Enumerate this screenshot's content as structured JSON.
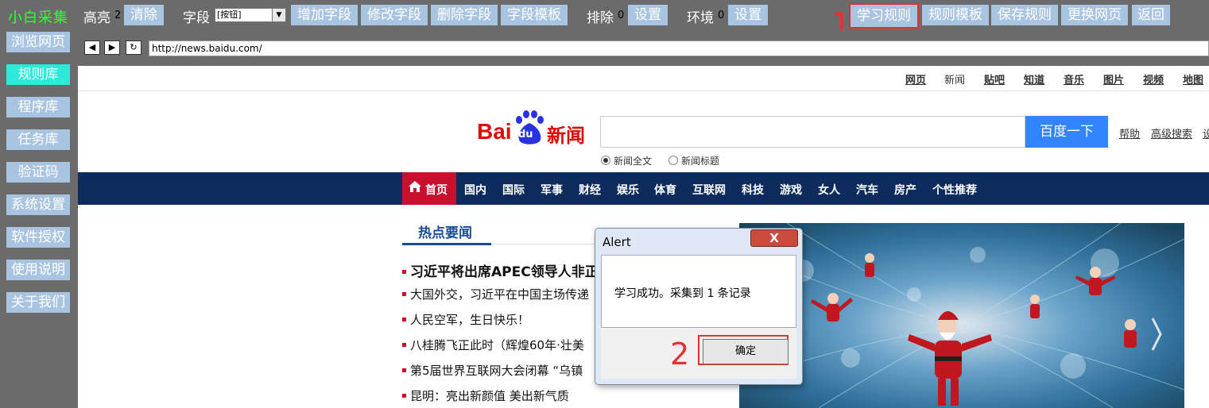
{
  "app": {
    "title": "小白采集"
  },
  "toolbar": {
    "highlight_label": "高亮",
    "highlight_count": "2",
    "clear_button": "清除",
    "field_label": "字段",
    "field_select_value": "[按钮]",
    "add_field": "增加字段",
    "edit_field": "修改字段",
    "delete_field": "删除字段",
    "field_template": "字段模板",
    "exclude_label": "排除",
    "exclude_count": "0",
    "exclude_settings": "设置",
    "env_label": "环境",
    "env_count": "0",
    "env_settings": "设置",
    "learn_rule": "学习规则",
    "rule_template": "规则模板",
    "save_rule": "保存规则",
    "change_page": "更换网页",
    "back": "返回"
  },
  "sidebar": {
    "items": [
      {
        "label": "浏览网页",
        "active": false
      },
      {
        "label": "规则库",
        "active": true
      },
      {
        "label": "程序库",
        "active": false
      },
      {
        "label": "任务库",
        "active": false
      },
      {
        "label": "验证码",
        "active": false
      },
      {
        "label": "系统设置",
        "active": false
      },
      {
        "label": "软件授权",
        "active": false
      },
      {
        "label": "使用说明",
        "active": false
      },
      {
        "label": "关于我们",
        "active": false
      }
    ]
  },
  "browser": {
    "url": "http://news.baidu.com/",
    "back_icon": "arrow-left-icon",
    "forward_icon": "arrow-right-icon",
    "refresh_icon": "refresh-icon"
  },
  "baidu": {
    "top_links": [
      "网页",
      "新闻",
      "贴吧",
      "知道",
      "音乐",
      "图片",
      "视频",
      "地图"
    ],
    "logo_text": "Bai",
    "logo_paw": "du",
    "logo_suffix": "新闻",
    "search_button": "百度一下",
    "help": "帮助",
    "advanced": "高级搜索",
    "settings": "设",
    "radio_fulltext": "新闻全文",
    "radio_title": "新闻标题",
    "nav": [
      "首页",
      "国内",
      "国际",
      "军事",
      "财经",
      "娱乐",
      "体育",
      "互联网",
      "科技",
      "游戏",
      "女人",
      "汽车",
      "房产",
      "个性推荐"
    ],
    "hot_title": "热点要闻",
    "headlines": [
      "习近平将出席APEC领导人非正",
      "大国外交，习近平在中国主场传递",
      "人民空军，生日快乐！",
      "八桂腾飞正此时（辉煌60年·壮美",
      "第5届世界互联网大会闭幕 “乌镇",
      "昆明：亮出新颜值 美出新气质"
    ]
  },
  "alert": {
    "title": "Alert",
    "close": "X",
    "message": "学习成功。采集到 1 条记录",
    "ok": "确定"
  },
  "annotations": {
    "step1": "1",
    "step2": "2"
  },
  "colors": {
    "toolbar_bg": "#6b6b6b",
    "button_bg": "#a9c4e0",
    "active_bg": "#2ee8d8",
    "annotation_red": "#e53030",
    "baidu_blue": "#3385ff",
    "nav_bg": "#0d2b5c"
  }
}
